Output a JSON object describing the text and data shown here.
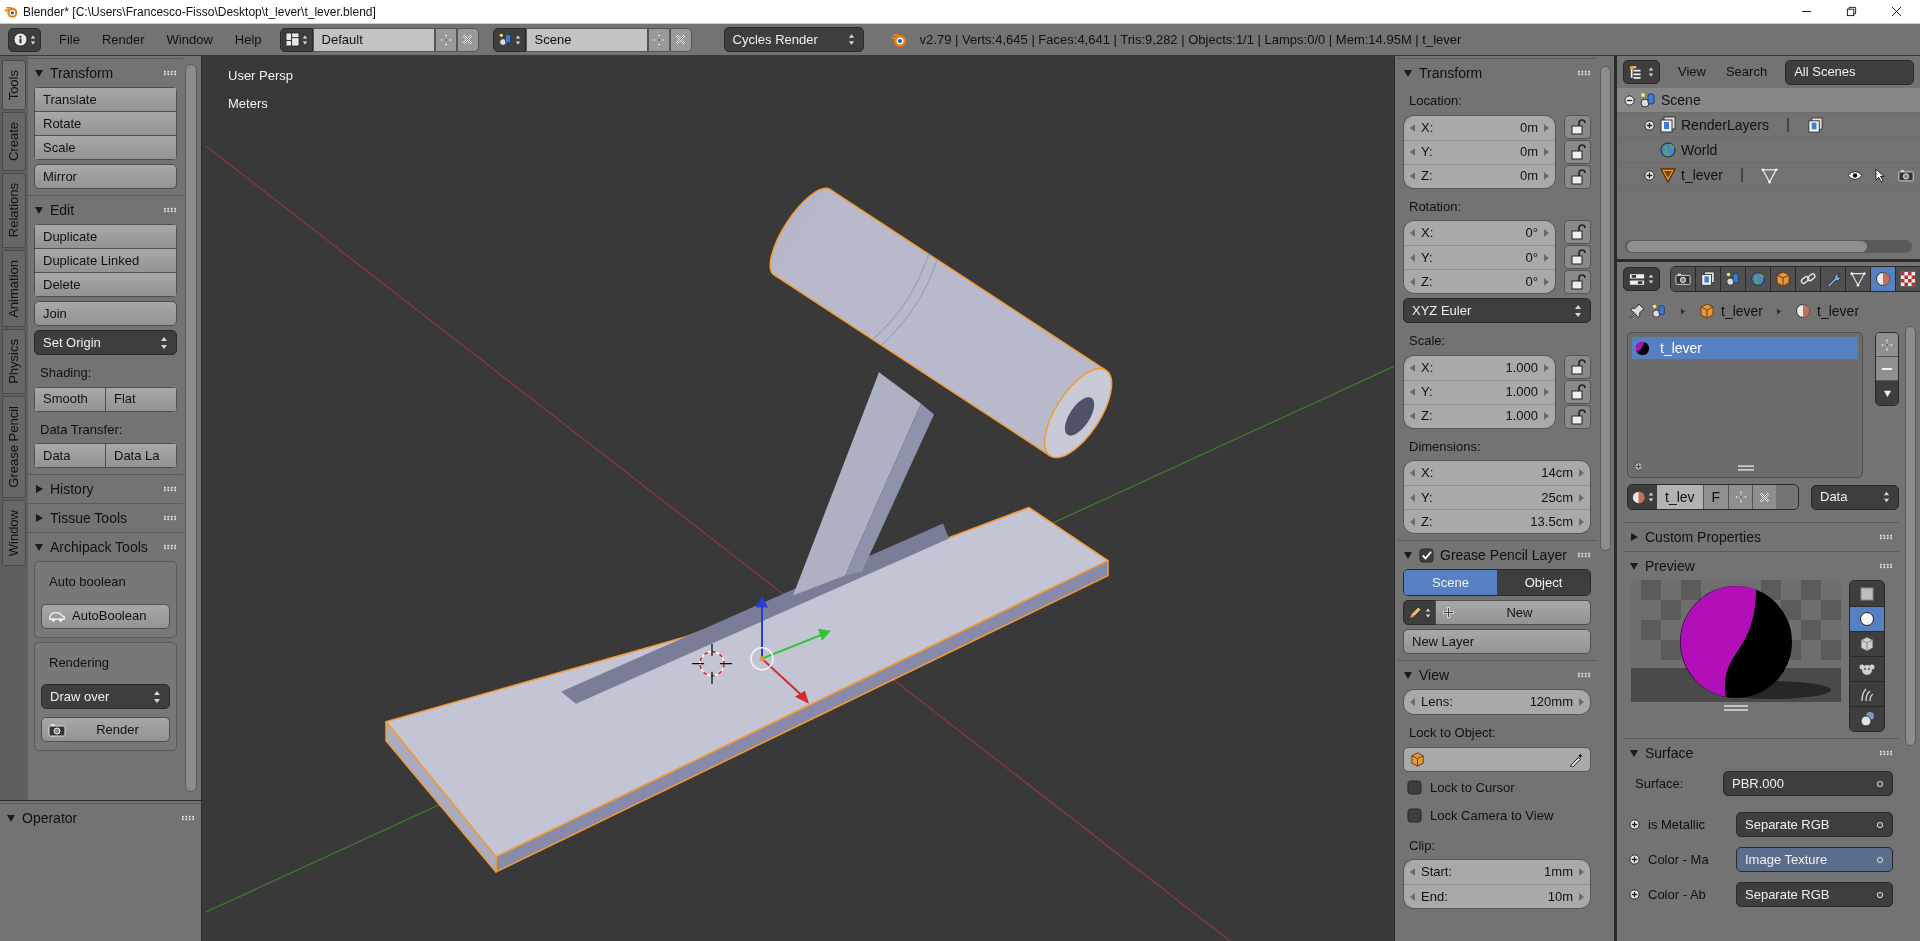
{
  "window": {
    "title": "Blender* [C:\\Users\\Francesco-Fisso\\Desktop\\t_lever\\t_lever.blend]"
  },
  "header": {
    "menus": [
      "File",
      "Render",
      "Window",
      "Help"
    ],
    "screen_layout": "Default",
    "scene": "Scene",
    "render_engine": "Cycles Render",
    "stats": "v2.79 | Verts:4,645 | Faces:4,641 | Tris:9,282 | Objects:1/1 | Lamps:0/0 | Mem:14.95M | t_lever"
  },
  "tool_tabs": [
    {
      "label": "Tools",
      "selected": true
    },
    {
      "label": "Create",
      "selected": false
    },
    {
      "label": "Relations",
      "selected": false
    },
    {
      "label": "Animation",
      "selected": false
    },
    {
      "label": "Physics",
      "selected": false
    },
    {
      "label": "Grease Pencil",
      "selected": false
    },
    {
      "label": "Window",
      "selected": false
    }
  ],
  "tool_shelf": [
    {
      "title": "Transform",
      "expanded": true,
      "items": [
        {
          "kind": "stack",
          "labels": [
            "Translate",
            "Rotate",
            "Scale"
          ]
        },
        {
          "kind": "button",
          "label": "Mirror"
        }
      ]
    },
    {
      "title": "Edit",
      "expanded": true,
      "items": [
        {
          "kind": "stack",
          "labels": [
            "Duplicate",
            "Duplicate Linked",
            "Delete"
          ]
        },
        {
          "kind": "button",
          "label": "Join"
        },
        {
          "kind": "dropdown",
          "value": "Set Origin"
        },
        {
          "kind": "label",
          "text": "Shading:"
        },
        {
          "kind": "row",
          "labels": [
            "Smooth",
            "Flat"
          ]
        },
        {
          "kind": "label",
          "text": "Data Transfer:"
        },
        {
          "kind": "row",
          "labels": [
            "Data",
            "Data La"
          ]
        }
      ]
    },
    {
      "title": "History",
      "expanded": false
    },
    {
      "title": "Tissue Tools",
      "expanded": false
    },
    {
      "title": "Archipack Tools",
      "expanded": true,
      "items": [
        {
          "kind": "box",
          "title": "Auto boolean",
          "items": [
            {
              "kind": "booleanbutton",
              "label": "AutoBoolean"
            }
          ]
        },
        {
          "kind": "box",
          "title": "Rendering",
          "items": [
            {
              "kind": "dropdown",
              "value": "Draw over"
            },
            {
              "kind": "renderbutton",
              "label": "Render"
            }
          ]
        }
      ]
    }
  ],
  "operator_panel": {
    "title": "Operator",
    "expanded": true
  },
  "viewport": {
    "view_name": "User Persp",
    "units": "Meters"
  },
  "properties_region": [
    {
      "title": "Transform",
      "expanded": true,
      "items": [
        {
          "kind": "label",
          "text": "Location:"
        },
        {
          "kind": "vector",
          "fields": [
            {
              "label": "X:",
              "value": "0m",
              "locked": false
            },
            {
              "label": "Y:",
              "value": "0m",
              "locked": false
            },
            {
              "label": "Z:",
              "value": "0m",
              "locked": false
            }
          ]
        },
        {
          "kind": "label",
          "text": "Rotation:"
        },
        {
          "kind": "vector",
          "fields": [
            {
              "label": "X:",
              "value": "0°",
              "locked": false
            },
            {
              "label": "Y:",
              "value": "0°",
              "locked": false
            },
            {
              "label": "Z:",
              "value": "0°",
              "locked": false
            }
          ]
        },
        {
          "kind": "dropdown",
          "value": "XYZ Euler"
        },
        {
          "kind": "label",
          "text": "Scale:"
        },
        {
          "kind": "vector",
          "fields": [
            {
              "label": "X:",
              "value": "1.000",
              "locked": false
            },
            {
              "label": "Y:",
              "value": "1.000",
              "locked": false
            },
            {
              "label": "Z:",
              "value": "1.000",
              "locked": false
            }
          ]
        },
        {
          "kind": "label",
          "text": "Dimensions:"
        },
        {
          "kind": "vector",
          "fields": [
            {
              "label": "X:",
              "value": "14cm"
            },
            {
              "label": "Y:",
              "value": "25cm"
            },
            {
              "label": "Z:",
              "value": "13.5cm"
            }
          ]
        }
      ]
    },
    {
      "title": "Grease Pencil Layer",
      "expanded": true,
      "enabled": true,
      "items": [
        {
          "kind": "toggle",
          "options": [
            {
              "label": "Scene",
              "selected": true
            },
            {
              "label": "Object",
              "selected": false
            }
          ]
        },
        {
          "kind": "newbutton",
          "label": "New"
        },
        {
          "kind": "button",
          "label": "New Layer"
        }
      ]
    },
    {
      "title": "View",
      "expanded": true,
      "items": [
        {
          "kind": "vector",
          "fields": [
            {
              "label": "Lens:",
              "value": "120mm"
            }
          ]
        },
        {
          "kind": "label",
          "text": "Lock to Object:"
        },
        {
          "kind": "objectfield"
        },
        {
          "kind": "checkbox",
          "label": "Lock to Cursor",
          "checked": false
        },
        {
          "kind": "checkbox",
          "label": "Lock Camera to View",
          "checked": false
        },
        {
          "kind": "label",
          "text": "Clip:"
        },
        {
          "kind": "vector",
          "fields": [
            {
              "label": "Start:",
              "value": "1mm"
            },
            {
              "label": "End:",
              "value": "10m"
            }
          ]
        }
      ]
    }
  ],
  "outliner": {
    "menus": [
      "View",
      "Search"
    ],
    "filter": "All Scenes",
    "tree": [
      {
        "label": "Scene",
        "kind": "scene",
        "expanded": true,
        "selected": true,
        "children": [
          {
            "label": "RenderLayers",
            "kind": "renderlayers",
            "expanded": false,
            "selected": false
          },
          {
            "label": "World",
            "kind": "world",
            "selected": false
          },
          {
            "label": "t_lever",
            "kind": "mesh",
            "expanded": false,
            "selected": false
          }
        ]
      }
    ]
  },
  "properties_editor": {
    "tabs": [
      {
        "kind": "render",
        "selected": false
      },
      {
        "kind": "layers",
        "selected": false
      },
      {
        "kind": "scene",
        "selected": false
      },
      {
        "kind": "world",
        "selected": false
      },
      {
        "kind": "object",
        "selected": false
      },
      {
        "kind": "constraints",
        "selected": false
      },
      {
        "kind": "modifiers",
        "selected": false
      },
      {
        "kind": "data",
        "selected": false
      },
      {
        "kind": "material",
        "selected": true
      },
      {
        "kind": "texture",
        "selected": false
      }
    ],
    "breadcrumb": [
      "t_lever",
      "t_lever"
    ],
    "material_slots": [
      {
        "name": "t_lever",
        "selected": true
      }
    ],
    "material_block": {
      "name": "t_lev",
      "users": "F",
      "link": "Data"
    },
    "panels": [
      {
        "title": "Custom Properties",
        "expanded": false
      },
      {
        "title": "Preview",
        "expanded": true,
        "items": [
          {
            "kind": "preview",
            "types": [
              {
                "kind": "flat",
                "selected": false
              },
              {
                "kind": "sphere",
                "selected": true
              },
              {
                "kind": "cube",
                "selected": false
              },
              {
                "kind": "monkey",
                "selected": false
              },
              {
                "kind": "hair",
                "selected": false
              },
              {
                "kind": "sky",
                "selected": false
              }
            ]
          }
        ]
      },
      {
        "title": "Surface",
        "expanded": true,
        "items": [
          {
            "kind": "surface",
            "label": "Surface:",
            "value": "PBR.000"
          },
          {
            "kind": "input",
            "label": "is Metallic",
            "value": "Separate RGB",
            "highlighted": false
          },
          {
            "kind": "input",
            "label": "Color - Ma",
            "value": "Image Texture",
            "highlighted": true
          },
          {
            "kind": "input",
            "label": "Color - Ab",
            "value": "Separate RGB",
            "highlighted": false
          }
        ]
      }
    ]
  }
}
